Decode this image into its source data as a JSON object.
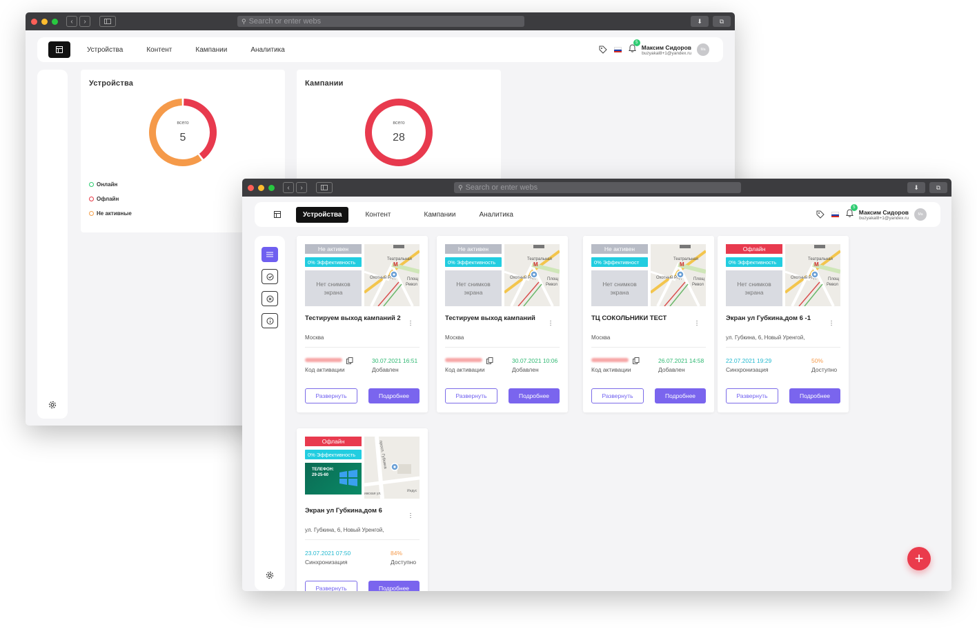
{
  "browser": {
    "url_placeholder": "Search or enter webs"
  },
  "header": {
    "nav": [
      "Устройства",
      "Контент",
      "Кампании",
      "Аналитика"
    ],
    "user_name": "Максим Сидоров",
    "user_email": "buzyakal8+1@yandex.ru",
    "avatar_initials": "Ма",
    "notifications": "5"
  },
  "dashboard": {
    "devices": {
      "title": "Устройства",
      "center_label": "всего",
      "total": "5",
      "legend": [
        {
          "label": "Онлайн",
          "color": "#2ecc71"
        },
        {
          "label": "Офлайн",
          "color": "#e63946"
        },
        {
          "label": "Не активные",
          "color": "#f5a04a"
        }
      ]
    },
    "campaigns": {
      "title": "Кампании",
      "center_label": "всего",
      "total": "28"
    }
  },
  "chart_data": [
    {
      "type": "pie",
      "title": "Устройства",
      "center_text": "5",
      "categories": [
        "Офлайн",
        "Не активные"
      ],
      "values": [
        2,
        3
      ],
      "colors": [
        "#e83a4e",
        "#f59a4a"
      ]
    },
    {
      "type": "pie",
      "title": "Кампании",
      "center_text": "28",
      "categories": [
        ""
      ],
      "values": [
        28
      ],
      "colors": [
        "#e83a4e"
      ]
    }
  ],
  "device_cards": [
    {
      "status": "Не активен",
      "status_color": "#b8bcc6",
      "efficiency": "0% Эффективность",
      "no_screenshot": "Нет снимков экрана",
      "title": "Тестируем выход кампаний 2",
      "address": "Москва",
      "left_label": "Код активации",
      "right_value": "30.07.2021 16:51",
      "right_color": "#2eb872",
      "right_label": "Добавлен",
      "btn_expand": "Развернуть",
      "btn_details": "Подробнее"
    },
    {
      "status": "Не активен",
      "status_color": "#b8bcc6",
      "efficiency": "0% Эффективность",
      "no_screenshot": "Нет снимков экрана",
      "title": "Тестируем выход кампаний",
      "address": "Москва",
      "left_label": "Код активации",
      "right_value": "30.07.2021 10:06",
      "right_color": "#2eb872",
      "right_label": "Добавлен",
      "btn_expand": "Развернуть",
      "btn_details": "Подробнее"
    },
    {
      "status": "Не активен",
      "status_color": "#b8bcc6",
      "efficiency": "0% Эффективност",
      "no_screenshot": "Нет снимков экрана",
      "title": "ТЦ СОКОЛЬНИКИ ТЕСТ",
      "address": "Москва",
      "left_label": "Код активации",
      "right_value": "26.07.2021 14:58",
      "right_color": "#2eb872",
      "right_label": "Добавлен",
      "btn_expand": "Развернуть",
      "btn_details": "Подробнее"
    },
    {
      "status": "Офлайн",
      "status_color": "#e83a4e",
      "efficiency": "0% Эффективность",
      "no_screenshot": "Нет снимков экрана",
      "title": "Экран ул Губкина,дом 6 -1",
      "address": "ул. Губкина, 6, Новый Уренгой,",
      "left_value": "22.07.2021 19:29",
      "left_color": "#22b8cf",
      "left_label": "Синхронизация",
      "right_value": "50%",
      "right_color": "#f59a4a",
      "right_label": "Доступно",
      "btn_expand": "Развернуть",
      "btn_details": "Подробнее"
    },
    {
      "status": "Офлайн",
      "status_color": "#e83a4e",
      "efficiency": "0% Эффективность",
      "screenshot_text": "ТЕЛЕФОН: 29-25-60",
      "title": "Экран ул Губкина,дом 6",
      "address": "ул. Губкина, 6, Новый Уренгой,",
      "left_value": "23.07.2021 07:50",
      "left_color": "#22b8cf",
      "left_label": "Синхронизация",
      "right_value": "84%",
      "right_color": "#f59a4a",
      "right_label": "Доступно",
      "btn_expand": "Развернуть",
      "btn_details": "Подробнее"
    }
  ],
  "map_labels": {
    "theatre": "Театральная",
    "ohotny": "Охотный Ряд",
    "plosh": "Площ",
    "revol": "Револ",
    "gubkina": "просп. Губкина",
    "ulica": "ижская ул.",
    "indus": "Индус"
  },
  "colors": {
    "accent": "#6f5ff0",
    "danger": "#e83a4e",
    "success": "#2eb872",
    "warn": "#f59a4a"
  }
}
